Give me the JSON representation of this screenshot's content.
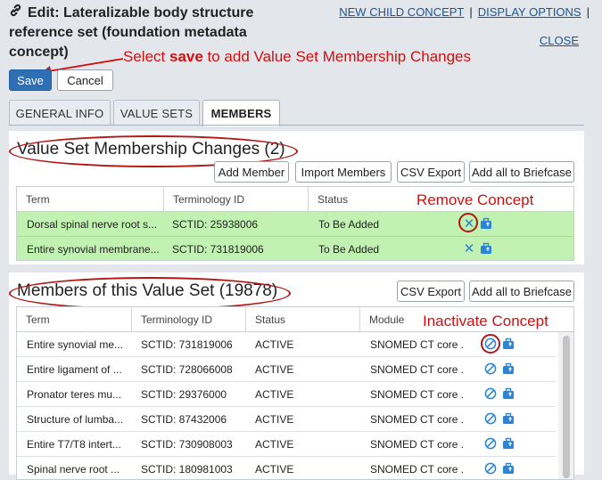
{
  "header": {
    "title": "Edit: Lateralizable body structure reference set (foundation metadata concept)",
    "links": {
      "new_child": "NEW CHILD CONCEPT",
      "separator": "|",
      "display_options": "DISPLAY OPTIONS",
      "close": "CLOSE"
    }
  },
  "annotations": {
    "save_prefix": "Select ",
    "save_bold": "save",
    "save_suffix": " to add Value Set Membership Changes",
    "remove": "Remove Concept",
    "inactivate": "Inactivate Concept"
  },
  "actions": {
    "save": "Save",
    "cancel": "Cancel"
  },
  "tabs": [
    {
      "label": "GENERAL INFO",
      "active": false
    },
    {
      "label": "VALUE SETS",
      "active": false
    },
    {
      "label": "MEMBERS",
      "active": true
    }
  ],
  "changes": {
    "title": "Value Set Membership Changes (2)",
    "buttons": {
      "add_member": "Add Member",
      "import_members": "Import Members",
      "csv_export": "CSV Export",
      "add_all": "Add all to Briefcase"
    },
    "columns": [
      "Term",
      "Terminology ID",
      "Status"
    ],
    "rows": [
      {
        "term": "Dorsal spinal nerve root s...",
        "id": "SCTID: 25938006",
        "status": "To Be Added"
      },
      {
        "term": "Entire synovial membrane...",
        "id": "SCTID: 731819006",
        "status": "To Be Added"
      }
    ]
  },
  "members": {
    "title": "Members of this Value Set (19878)",
    "buttons": {
      "csv_export": "CSV Export",
      "add_all": "Add all to Briefcase"
    },
    "columns": [
      "Term",
      "Terminology ID",
      "Status",
      "Module"
    ],
    "rows": [
      {
        "term": "Entire synovial me...",
        "id": "SCTID: 731819006",
        "status": "ACTIVE",
        "module": "SNOMED CT core ..."
      },
      {
        "term": "Entire ligament of ...",
        "id": "SCTID: 728066008",
        "status": "ACTIVE",
        "module": "SNOMED CT core ..."
      },
      {
        "term": "Pronator teres mu...",
        "id": "SCTID: 29376000",
        "status": "ACTIVE",
        "module": "SNOMED CT core ..."
      },
      {
        "term": "Structure of lumba...",
        "id": "SCTID: 87432006",
        "status": "ACTIVE",
        "module": "SNOMED CT core ..."
      },
      {
        "term": "Entire T7/T8 intert...",
        "id": "SCTID: 730908003",
        "status": "ACTIVE",
        "module": "SNOMED CT core ..."
      },
      {
        "term": "Spinal nerve root ...",
        "id": "SCTID: 180981003",
        "status": "ACTIVE",
        "module": "SNOMED CT core ..."
      }
    ]
  },
  "colors": {
    "accent": "#2f6fb5",
    "link": "#1a5597",
    "annotation": "#d01010",
    "added_row": "#c2f2b2",
    "icon": "#2b84d6"
  }
}
